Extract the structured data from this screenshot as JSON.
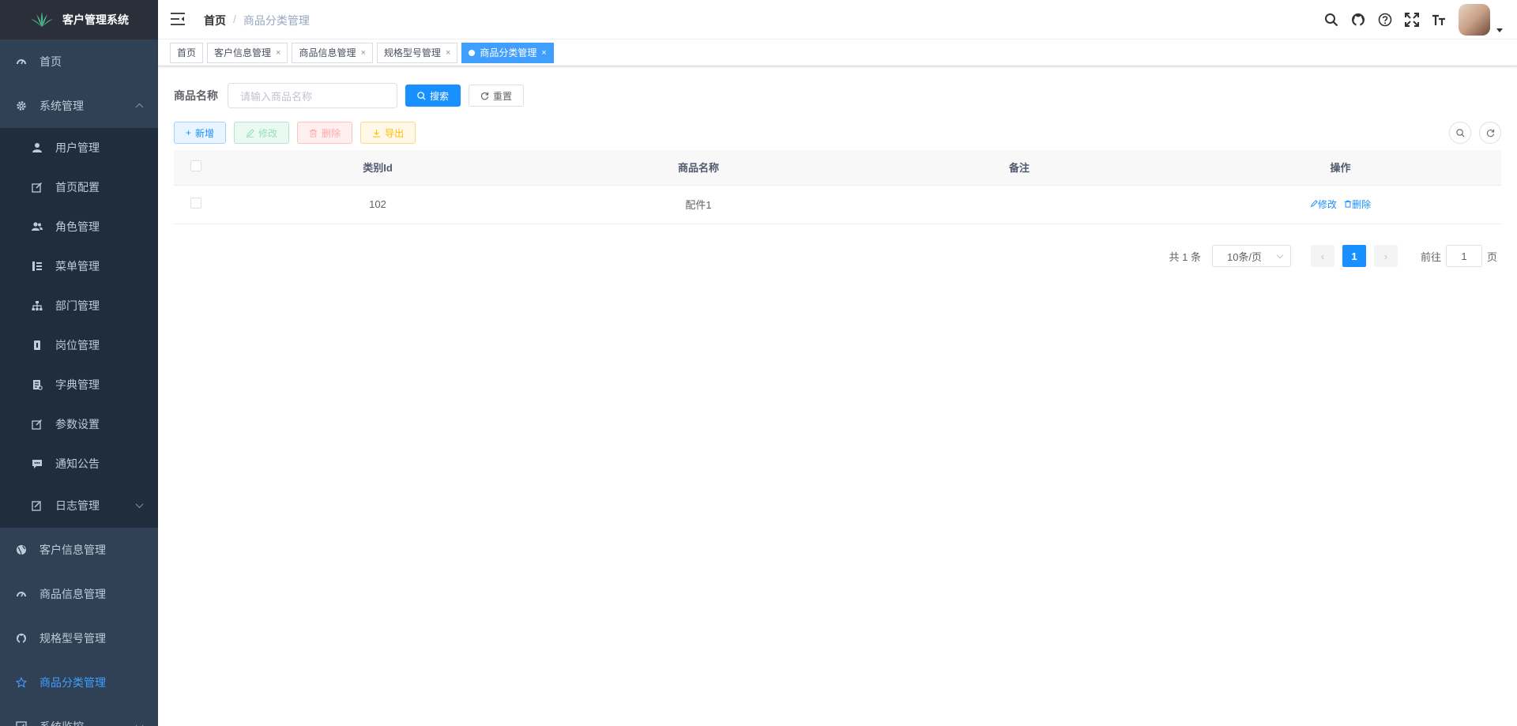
{
  "app": {
    "title": "客户管理系统"
  },
  "sidebar": {
    "items": [
      {
        "label": "首页",
        "icon": "dashboard-icon"
      },
      {
        "label": "系统管理",
        "icon": "system-icon",
        "expanded": true,
        "children": [
          {
            "label": "用户管理",
            "icon": "user-icon"
          },
          {
            "label": "首页配置",
            "icon": "edit-icon"
          },
          {
            "label": "角色管理",
            "icon": "peoples-icon"
          },
          {
            "label": "菜单管理",
            "icon": "tree-table-icon"
          },
          {
            "label": "部门管理",
            "icon": "tree-icon"
          },
          {
            "label": "岗位管理",
            "icon": "post-icon"
          },
          {
            "label": "字典管理",
            "icon": "dict-icon"
          },
          {
            "label": "参数设置",
            "icon": "edit-icon"
          },
          {
            "label": "通知公告",
            "icon": "message-icon"
          },
          {
            "label": "日志管理",
            "icon": "log-icon"
          }
        ]
      },
      {
        "label": "客户信息管理",
        "icon": "globe-icon"
      },
      {
        "label": "商品信息管理",
        "icon": "dashboard-icon"
      },
      {
        "label": "规格型号管理",
        "icon": "github-icon"
      },
      {
        "label": "商品分类管理",
        "icon": "star-icon",
        "active": true
      },
      {
        "label": "系统监控",
        "icon": "monitor-icon"
      }
    ]
  },
  "breadcrumb": {
    "home": "首页",
    "separator": "/",
    "current": "商品分类管理"
  },
  "tags": [
    {
      "label": "首页",
      "closable": false
    },
    {
      "label": "客户信息管理",
      "closable": true
    },
    {
      "label": "商品信息管理",
      "closable": true
    },
    {
      "label": "规格型号管理",
      "closable": true
    },
    {
      "label": "商品分类管理",
      "closable": true,
      "active": true
    }
  ],
  "search": {
    "label": "商品名称",
    "placeholder": "请输入商品名称",
    "search_btn": "搜索",
    "reset_btn": "重置"
  },
  "toolbar": {
    "add": "新增",
    "edit": "修改",
    "delete": "删除",
    "export": "导出"
  },
  "table": {
    "columns": [
      "类别Id",
      "商品名称",
      "备注",
      "操作"
    ],
    "rows": [
      {
        "id": "102",
        "name": "配件1",
        "remark": "",
        "edit": "修改",
        "delete": "删除"
      }
    ]
  },
  "pagination": {
    "total": "共 1 条",
    "page_size": "10条/页",
    "current": "1",
    "goto_prefix": "前往",
    "goto_value": "1",
    "goto_suffix": "页"
  },
  "colors": {
    "sidebar_bg": "#304156",
    "submenu_bg": "#1f2d3d",
    "primary": "#1890ff",
    "active_menu": "#409eff"
  }
}
